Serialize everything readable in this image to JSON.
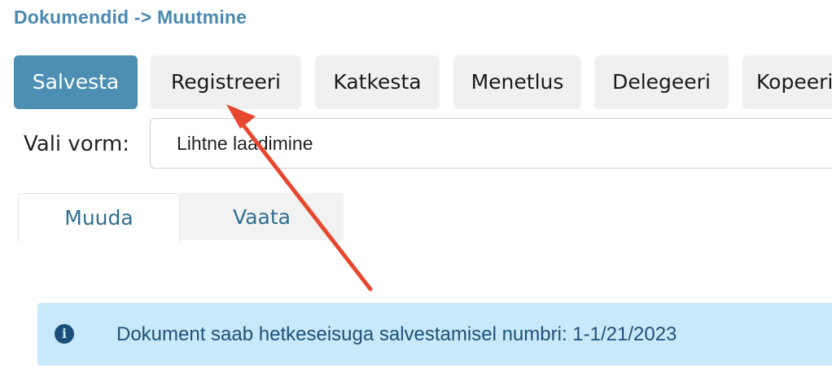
{
  "breadcrumb": "Dokumendid -> Muutmine",
  "toolbar": {
    "buttons": [
      {
        "label": "Salvesta"
      },
      {
        "label": "Registreeri"
      },
      {
        "label": "Katkesta"
      },
      {
        "label": "Menetlus"
      },
      {
        "label": "Delegeeri"
      },
      {
        "label": "Kopeeri"
      }
    ]
  },
  "form": {
    "label": "Vali vorm:",
    "selected_value": "Lihtne laadimine"
  },
  "tabs": [
    {
      "label": "Muuda",
      "active": true
    },
    {
      "label": "Vaata",
      "active": false
    }
  ],
  "info": {
    "icon": "info-circle-icon",
    "icon_glyph": "i",
    "message": "Dokument saab hetkeseisuga salvestamisel numbri: 1-1/21/2023"
  },
  "annotation": {
    "type": "arrow",
    "color": "#e8472f"
  }
}
